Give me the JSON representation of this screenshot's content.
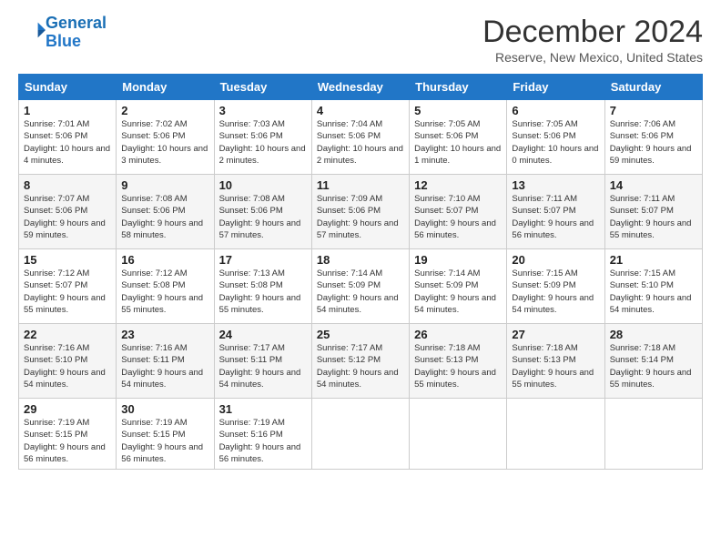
{
  "logo": {
    "line1": "General",
    "line2": "Blue"
  },
  "title": "December 2024",
  "location": "Reserve, New Mexico, United States",
  "days_header": [
    "Sunday",
    "Monday",
    "Tuesday",
    "Wednesday",
    "Thursday",
    "Friday",
    "Saturday"
  ],
  "weeks": [
    [
      {
        "num": "1",
        "sunrise": "Sunrise: 7:01 AM",
        "sunset": "Sunset: 5:06 PM",
        "daylight": "Daylight: 10 hours and 4 minutes."
      },
      {
        "num": "2",
        "sunrise": "Sunrise: 7:02 AM",
        "sunset": "Sunset: 5:06 PM",
        "daylight": "Daylight: 10 hours and 3 minutes."
      },
      {
        "num": "3",
        "sunrise": "Sunrise: 7:03 AM",
        "sunset": "Sunset: 5:06 PM",
        "daylight": "Daylight: 10 hours and 2 minutes."
      },
      {
        "num": "4",
        "sunrise": "Sunrise: 7:04 AM",
        "sunset": "Sunset: 5:06 PM",
        "daylight": "Daylight: 10 hours and 2 minutes."
      },
      {
        "num": "5",
        "sunrise": "Sunrise: 7:05 AM",
        "sunset": "Sunset: 5:06 PM",
        "daylight": "Daylight: 10 hours and 1 minute."
      },
      {
        "num": "6",
        "sunrise": "Sunrise: 7:05 AM",
        "sunset": "Sunset: 5:06 PM",
        "daylight": "Daylight: 10 hours and 0 minutes."
      },
      {
        "num": "7",
        "sunrise": "Sunrise: 7:06 AM",
        "sunset": "Sunset: 5:06 PM",
        "daylight": "Daylight: 9 hours and 59 minutes."
      }
    ],
    [
      {
        "num": "8",
        "sunrise": "Sunrise: 7:07 AM",
        "sunset": "Sunset: 5:06 PM",
        "daylight": "Daylight: 9 hours and 59 minutes."
      },
      {
        "num": "9",
        "sunrise": "Sunrise: 7:08 AM",
        "sunset": "Sunset: 5:06 PM",
        "daylight": "Daylight: 9 hours and 58 minutes."
      },
      {
        "num": "10",
        "sunrise": "Sunrise: 7:08 AM",
        "sunset": "Sunset: 5:06 PM",
        "daylight": "Daylight: 9 hours and 57 minutes."
      },
      {
        "num": "11",
        "sunrise": "Sunrise: 7:09 AM",
        "sunset": "Sunset: 5:06 PM",
        "daylight": "Daylight: 9 hours and 57 minutes."
      },
      {
        "num": "12",
        "sunrise": "Sunrise: 7:10 AM",
        "sunset": "Sunset: 5:07 PM",
        "daylight": "Daylight: 9 hours and 56 minutes."
      },
      {
        "num": "13",
        "sunrise": "Sunrise: 7:11 AM",
        "sunset": "Sunset: 5:07 PM",
        "daylight": "Daylight: 9 hours and 56 minutes."
      },
      {
        "num": "14",
        "sunrise": "Sunrise: 7:11 AM",
        "sunset": "Sunset: 5:07 PM",
        "daylight": "Daylight: 9 hours and 55 minutes."
      }
    ],
    [
      {
        "num": "15",
        "sunrise": "Sunrise: 7:12 AM",
        "sunset": "Sunset: 5:07 PM",
        "daylight": "Daylight: 9 hours and 55 minutes."
      },
      {
        "num": "16",
        "sunrise": "Sunrise: 7:12 AM",
        "sunset": "Sunset: 5:08 PM",
        "daylight": "Daylight: 9 hours and 55 minutes."
      },
      {
        "num": "17",
        "sunrise": "Sunrise: 7:13 AM",
        "sunset": "Sunset: 5:08 PM",
        "daylight": "Daylight: 9 hours and 55 minutes."
      },
      {
        "num": "18",
        "sunrise": "Sunrise: 7:14 AM",
        "sunset": "Sunset: 5:09 PM",
        "daylight": "Daylight: 9 hours and 54 minutes."
      },
      {
        "num": "19",
        "sunrise": "Sunrise: 7:14 AM",
        "sunset": "Sunset: 5:09 PM",
        "daylight": "Daylight: 9 hours and 54 minutes."
      },
      {
        "num": "20",
        "sunrise": "Sunrise: 7:15 AM",
        "sunset": "Sunset: 5:09 PM",
        "daylight": "Daylight: 9 hours and 54 minutes."
      },
      {
        "num": "21",
        "sunrise": "Sunrise: 7:15 AM",
        "sunset": "Sunset: 5:10 PM",
        "daylight": "Daylight: 9 hours and 54 minutes."
      }
    ],
    [
      {
        "num": "22",
        "sunrise": "Sunrise: 7:16 AM",
        "sunset": "Sunset: 5:10 PM",
        "daylight": "Daylight: 9 hours and 54 minutes."
      },
      {
        "num": "23",
        "sunrise": "Sunrise: 7:16 AM",
        "sunset": "Sunset: 5:11 PM",
        "daylight": "Daylight: 9 hours and 54 minutes."
      },
      {
        "num": "24",
        "sunrise": "Sunrise: 7:17 AM",
        "sunset": "Sunset: 5:11 PM",
        "daylight": "Daylight: 9 hours and 54 minutes."
      },
      {
        "num": "25",
        "sunrise": "Sunrise: 7:17 AM",
        "sunset": "Sunset: 5:12 PM",
        "daylight": "Daylight: 9 hours and 54 minutes."
      },
      {
        "num": "26",
        "sunrise": "Sunrise: 7:18 AM",
        "sunset": "Sunset: 5:13 PM",
        "daylight": "Daylight: 9 hours and 55 minutes."
      },
      {
        "num": "27",
        "sunrise": "Sunrise: 7:18 AM",
        "sunset": "Sunset: 5:13 PM",
        "daylight": "Daylight: 9 hours and 55 minutes."
      },
      {
        "num": "28",
        "sunrise": "Sunrise: 7:18 AM",
        "sunset": "Sunset: 5:14 PM",
        "daylight": "Daylight: 9 hours and 55 minutes."
      }
    ],
    [
      {
        "num": "29",
        "sunrise": "Sunrise: 7:19 AM",
        "sunset": "Sunset: 5:15 PM",
        "daylight": "Daylight: 9 hours and 56 minutes."
      },
      {
        "num": "30",
        "sunrise": "Sunrise: 7:19 AM",
        "sunset": "Sunset: 5:15 PM",
        "daylight": "Daylight: 9 hours and 56 minutes."
      },
      {
        "num": "31",
        "sunrise": "Sunrise: 7:19 AM",
        "sunset": "Sunset: 5:16 PM",
        "daylight": "Daylight: 9 hours and 56 minutes."
      },
      null,
      null,
      null,
      null
    ]
  ]
}
